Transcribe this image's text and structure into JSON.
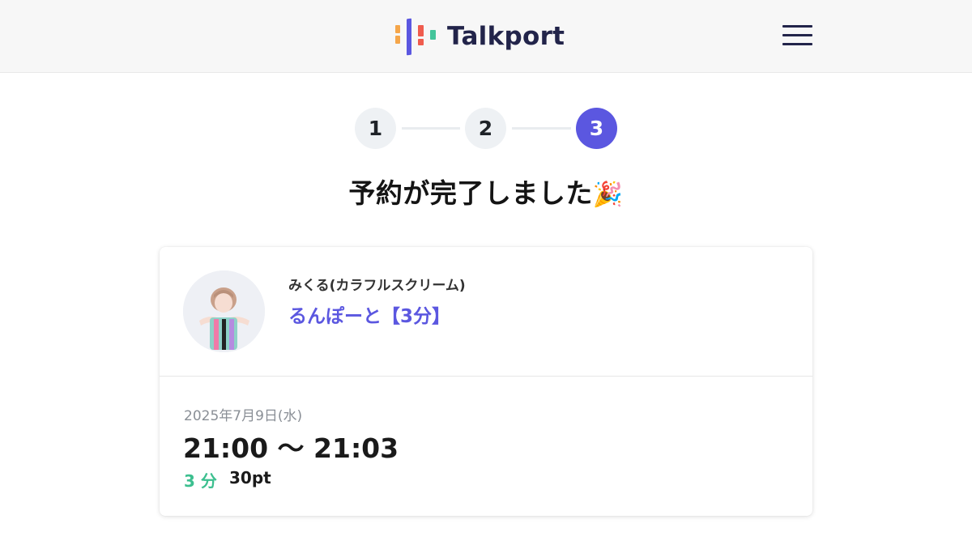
{
  "header": {
    "brand": "Talkport",
    "logo_icon": "talkport-logo-bars",
    "menu_icon": "hamburger-menu-icon",
    "colors": {
      "bar_orange": "#f5a64a",
      "bar_red": "#ef5c4e",
      "bar_purple": "#5b57e0",
      "bar_green": "#43c49a",
      "text": "#22244a"
    }
  },
  "steps": {
    "items": [
      {
        "label": "1",
        "state": "done"
      },
      {
        "label": "2",
        "state": "done"
      },
      {
        "label": "3",
        "state": "active"
      }
    ],
    "active_color": "#5b57e0"
  },
  "title": {
    "text": "予約が完了しました",
    "emoji": "🎉"
  },
  "reservation": {
    "artist": "みくる(カラフルスクリーム)",
    "product": "るんぽーと【3分】",
    "date": "2025年7月9日(水)",
    "time_range": "21:00 〜 21:03",
    "duration": "3 分",
    "points": "30pt",
    "accent_color": "#3cbf8f"
  }
}
